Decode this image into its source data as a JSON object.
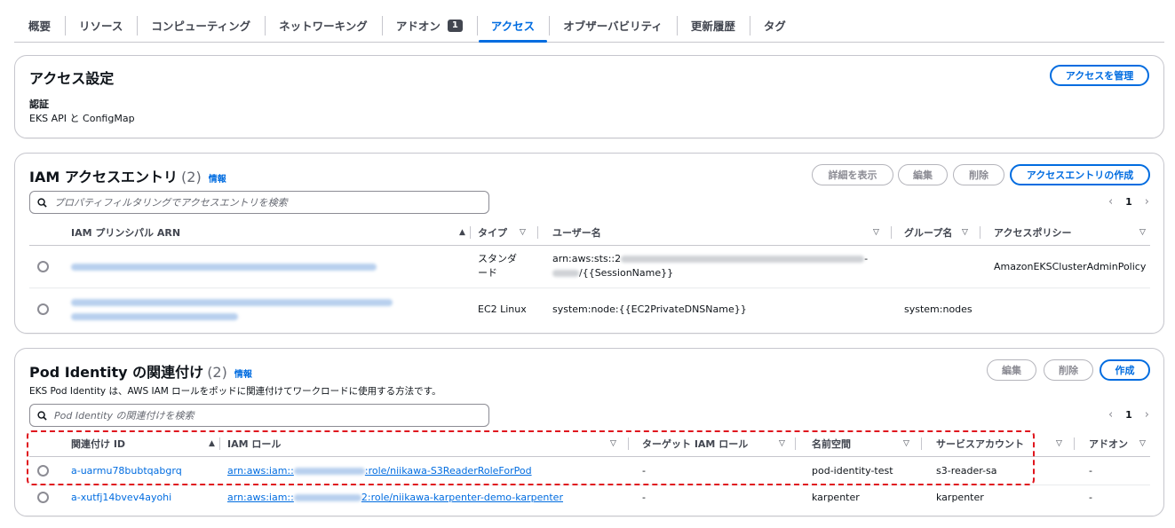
{
  "tabs": [
    {
      "label": "概要"
    },
    {
      "label": "リソース"
    },
    {
      "label": "コンピューティング"
    },
    {
      "label": "ネットワーキング"
    },
    {
      "label": "アドオン",
      "badge": "1"
    },
    {
      "label": "アクセス",
      "active": true
    },
    {
      "label": "オブザーバビリティ"
    },
    {
      "label": "更新履歴"
    },
    {
      "label": "タグ"
    }
  ],
  "access_settings": {
    "title": "アクセス設定",
    "manage_button": "アクセスを管理",
    "auth_label": "認証",
    "auth_value": "EKS API と ConfigMap"
  },
  "iam_entries": {
    "title": "IAM アクセスエントリ",
    "count": "(2)",
    "info": "情報",
    "buttons": {
      "details": "詳細を表示",
      "edit": "編集",
      "delete": "削除",
      "create": "アクセスエントリの作成"
    },
    "search_placeholder": "プロパティフィルタリングでアクセスエントリを検索",
    "page": "1",
    "columns": {
      "arn": "IAM プリンシパル ARN",
      "type": "タイプ",
      "user": "ユーザー名",
      "group": "グループ名",
      "policy": "アクセスポリシー"
    },
    "rows": [
      {
        "type_line1": "スタンダ",
        "type_line2": "ード",
        "user_line1": "arn:aws:sts::2",
        "user_line1_end": "-",
        "user_line2": "/{{SessionName}}",
        "group": "",
        "policy": "AmazonEKSClusterAdminPolicy"
      },
      {
        "type_line1": "EC2 Linux",
        "user_line1": "system:node:{{EC2PrivateDNSName}}",
        "group": "system:nodes",
        "policy": ""
      }
    ]
  },
  "pod_identity": {
    "title": "Pod Identity の関連付け",
    "count": "(2)",
    "info": "情報",
    "description": "EKS Pod Identity は、AWS IAM ロールをポッドに関連付けてワークロードに使用する方法です。",
    "buttons": {
      "edit": "編集",
      "delete": "削除",
      "create": "作成"
    },
    "search_placeholder": "Pod Identity の関連付けを検索",
    "page": "1",
    "columns": {
      "id": "関連付け ID",
      "role": "IAM ロール",
      "target": "ターゲット IAM ロール",
      "namespace": "名前空間",
      "sa": "サービスアカウント",
      "addon": "アドオン"
    },
    "rows": [
      {
        "id": "a-uarmu78bubtqabgrq",
        "role_prefix": "arn:aws:iam::",
        "role_suffix": ":role/niikawa-S3ReaderRoleForPod",
        "target": "-",
        "namespace": "pod-identity-test",
        "sa": "s3-reader-sa",
        "addon": "-"
      },
      {
        "id": "a-xutfj14bvev4ayohi",
        "role_prefix": "arn:aws:iam::",
        "role_suffix": "2:role/niikawa-karpenter-demo-karpenter",
        "target": "-",
        "namespace": "karpenter",
        "sa": "karpenter",
        "addon": "-"
      }
    ]
  },
  "colors": {
    "accent": "#006ce0",
    "highlight": "#e0161e",
    "border": "#c6c6cd"
  }
}
